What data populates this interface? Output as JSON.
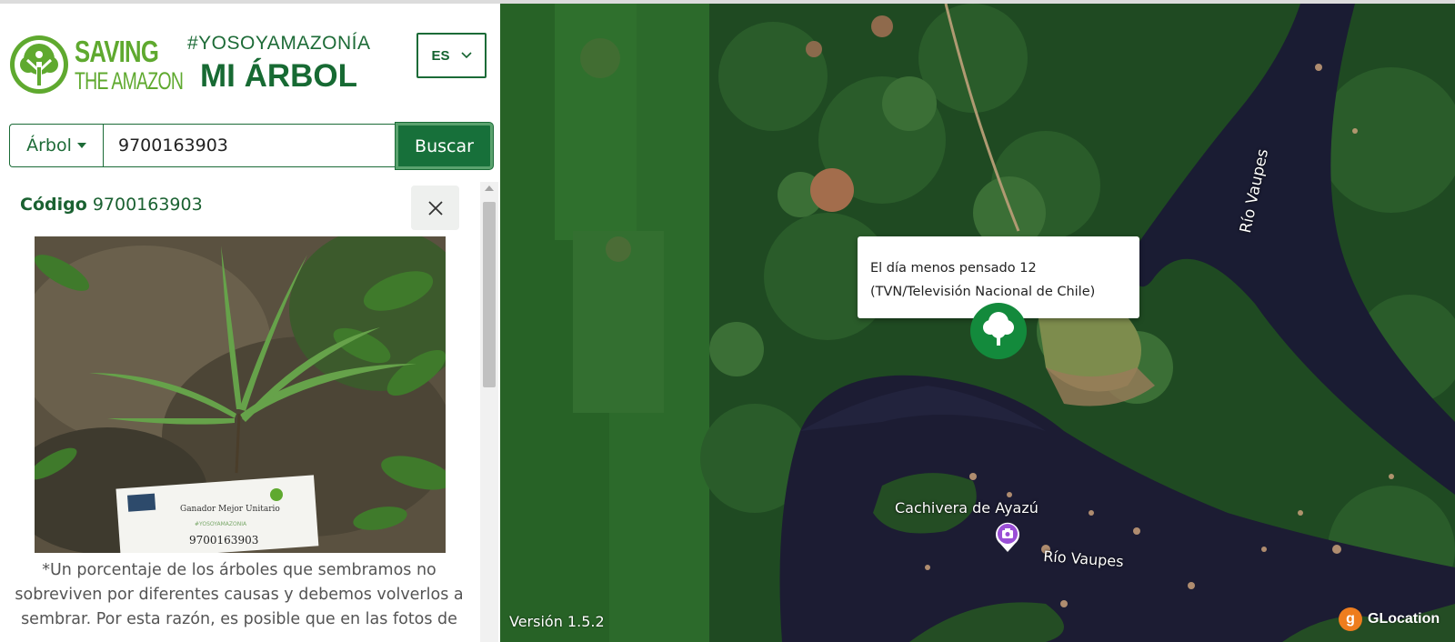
{
  "header": {
    "logo_line1": "SAVING",
    "logo_line2": "THE AMAZON",
    "hashtag": "#YOSOYAMAZONÍA",
    "title": "MI ÁRBOL",
    "language": "ES"
  },
  "search": {
    "type_label": "Árbol",
    "value": "9700163903",
    "button_label": "Buscar"
  },
  "tree": {
    "code_label": "Código",
    "code_value": "9700163903",
    "photo_card": {
      "label": "Ganador Mejor Unitario",
      "hashtag": "#YOSOYAMAZONIA",
      "code": "9700163903"
    },
    "note": "*Un porcentaje de los árboles que sembramos no sobreviven por diferentes causas y debemos volverlos a sembrar. Por esta razón, es posible que en las fotos de"
  },
  "map": {
    "popup_line1": "El día menos pensado 12",
    "popup_line2": "(TVN/Televisión Nacional de Chile)",
    "labels": {
      "cachivera": "Cachivera de Ayazú",
      "rio_lower": "Río Vaupes",
      "rio_upper": "Río Vaupes"
    },
    "version": "Versión 1.5.2",
    "brand": "GLocation",
    "brand_initial": "g"
  },
  "colors": {
    "brand_green": "#17703a",
    "logo_green": "#5fa92f",
    "marker_green": "#138a3c",
    "poi_purple": "#9a4fd6"
  }
}
